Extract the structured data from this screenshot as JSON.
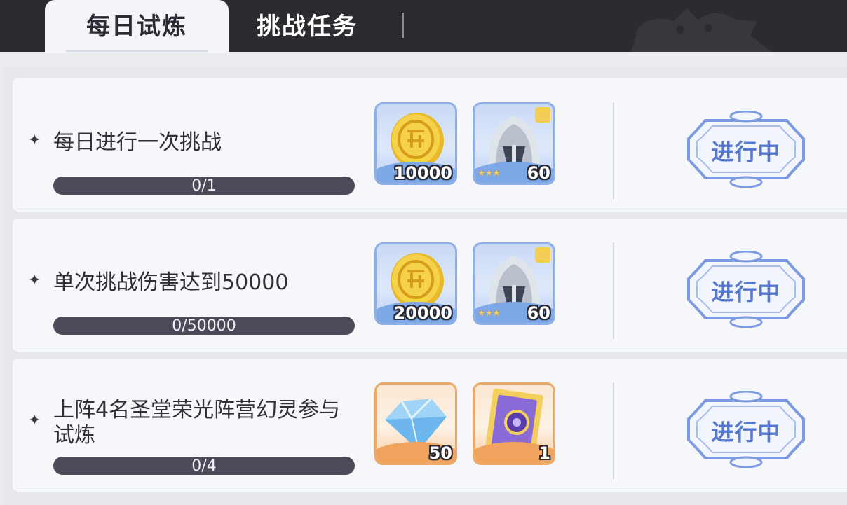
{
  "tabs": {
    "daily": "每日试炼",
    "challenge": "挑战任务"
  },
  "colors": {
    "topbar": "#2c2c30",
    "accent_blue": "#5478cf",
    "progress_track": "#4a4a58"
  },
  "tasks": [
    {
      "title": "每日进行一次挑战",
      "progress_text": "0/1",
      "progress": 0,
      "rewards": [
        {
          "icon": "gold-coin-icon",
          "count": "10000",
          "rarity": "blue"
        },
        {
          "icon": "knight-helmet-icon",
          "count": "60",
          "rarity": "blue",
          "stars": 3
        }
      ],
      "status": "进行中"
    },
    {
      "title": "单次挑战伤害达到50000",
      "progress_text": "0/50000",
      "progress": 0,
      "rewards": [
        {
          "icon": "gold-coin-icon",
          "count": "20000",
          "rarity": "blue"
        },
        {
          "icon": "knight-helmet-icon",
          "count": "60",
          "rarity": "blue",
          "stars": 3
        }
      ],
      "status": "进行中"
    },
    {
      "title": "上阵4名圣堂荣光阵营幻灵参与试炼",
      "progress_text": "0/4",
      "progress": 0,
      "rewards": [
        {
          "icon": "diamond-icon",
          "count": "50",
          "rarity": "orange"
        },
        {
          "icon": "card-icon",
          "count": "1",
          "rarity": "orange"
        }
      ],
      "status": "进行中"
    }
  ]
}
